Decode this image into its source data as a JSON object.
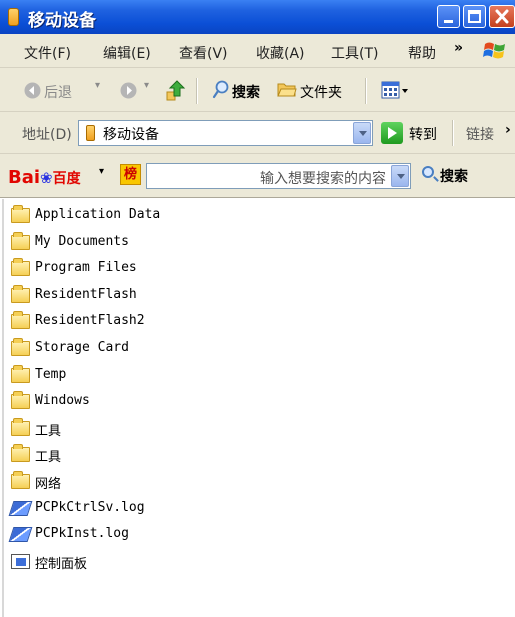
{
  "window": {
    "title": "移动设备"
  },
  "menu": {
    "items": [
      "文件(F)",
      "编辑(E)",
      "查看(V)",
      "收藏(A)",
      "工具(T)",
      "帮助"
    ],
    "overflow": "»"
  },
  "toolbar": {
    "back": "后退",
    "search": "搜索",
    "folders": "文件夹"
  },
  "address": {
    "label": "地址(D)",
    "value": "移动设备",
    "go": "转到",
    "links": "链接"
  },
  "baidu": {
    "brand_left": "Bai",
    "brand_right": "百度",
    "placeholder": "输入想要搜索的内容",
    "search_button": "搜索",
    "bang": "榜"
  },
  "files": [
    {
      "name": "Application Data",
      "type": "folder"
    },
    {
      "name": "My Documents",
      "type": "folder"
    },
    {
      "name": "Program Files",
      "type": "folder"
    },
    {
      "name": "ResidentFlash",
      "type": "folder"
    },
    {
      "name": "ResidentFlash2",
      "type": "folder"
    },
    {
      "name": "Storage Card",
      "type": "folder"
    },
    {
      "name": "Temp",
      "type": "folder"
    },
    {
      "name": "Windows",
      "type": "folder"
    },
    {
      "name": "工具",
      "type": "folder"
    },
    {
      "name": "工具",
      "type": "folder"
    },
    {
      "name": "网络",
      "type": "folder"
    },
    {
      "name": "PCPkCtrlSv.log",
      "type": "log"
    },
    {
      "name": "PCPkInst.log",
      "type": "log"
    },
    {
      "name": "控制面板",
      "type": "control-panel"
    }
  ]
}
